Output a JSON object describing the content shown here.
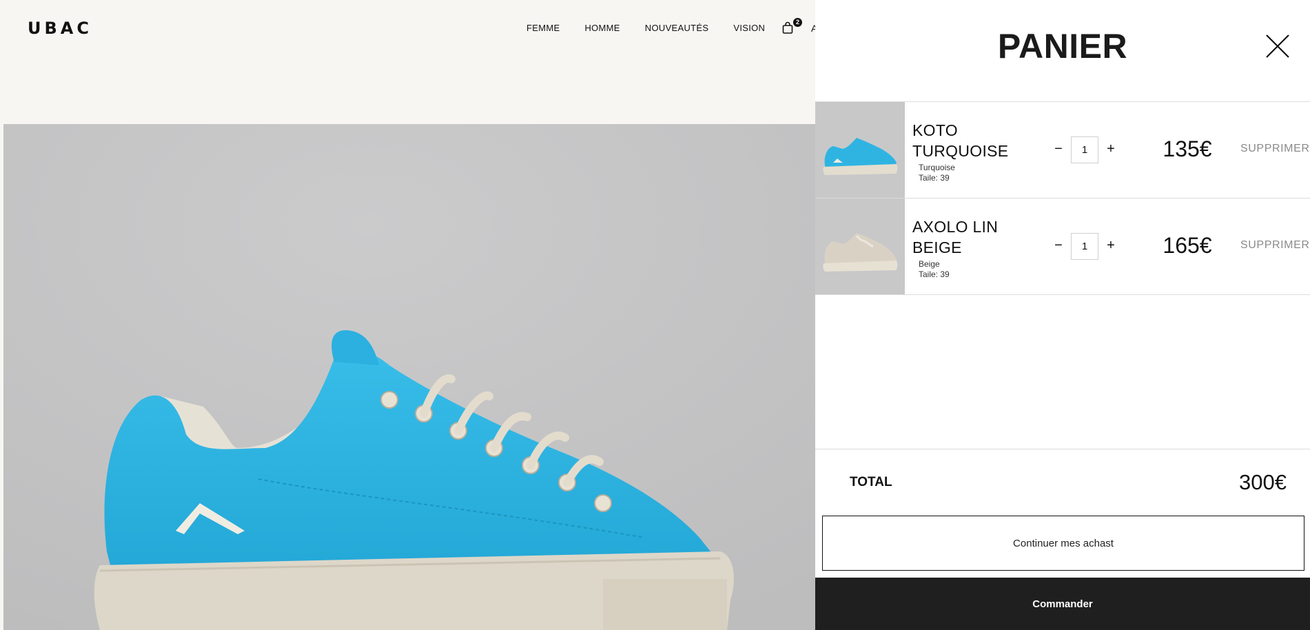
{
  "site": {
    "logo": "UBAC",
    "nav": [
      {
        "label": "FEMME"
      },
      {
        "label": "HOMME"
      },
      {
        "label": "NOUVEAUTÉS"
      },
      {
        "label": "VISION"
      }
    ],
    "cart_count": "2",
    "account_partial": "A"
  },
  "colors": {
    "accent_sneaker": "#2fb4e2",
    "sole": "#ddd7c9",
    "hero_bg": "#c4c4c5",
    "drawer_bg": "#ffffff",
    "checkout_bg": "#1f1f1f",
    "muted_text": "#8a8a8a"
  },
  "icons": {
    "bag": "shopping-bag-icon",
    "close": "close-icon"
  },
  "cart": {
    "title": "PANIER",
    "items": [
      {
        "name": "KOTO TURQUOISE",
        "color": "Turquoise",
        "size": "Taile: 39",
        "quantity": "1",
        "minus": "−",
        "plus": "+",
        "price": "135€",
        "remove": "SUPPRIMER"
      },
      {
        "name": "AXOLO LIN BEIGE",
        "color": "Beige",
        "size": "Taile: 39",
        "quantity": "1",
        "minus": "−",
        "plus": "+",
        "price": "165€",
        "remove": "SUPPRIMER"
      }
    ],
    "total_label": "TOTAL",
    "total_value": "300€",
    "continue_label": "Continuer mes achast",
    "checkout_label": "Commander"
  }
}
